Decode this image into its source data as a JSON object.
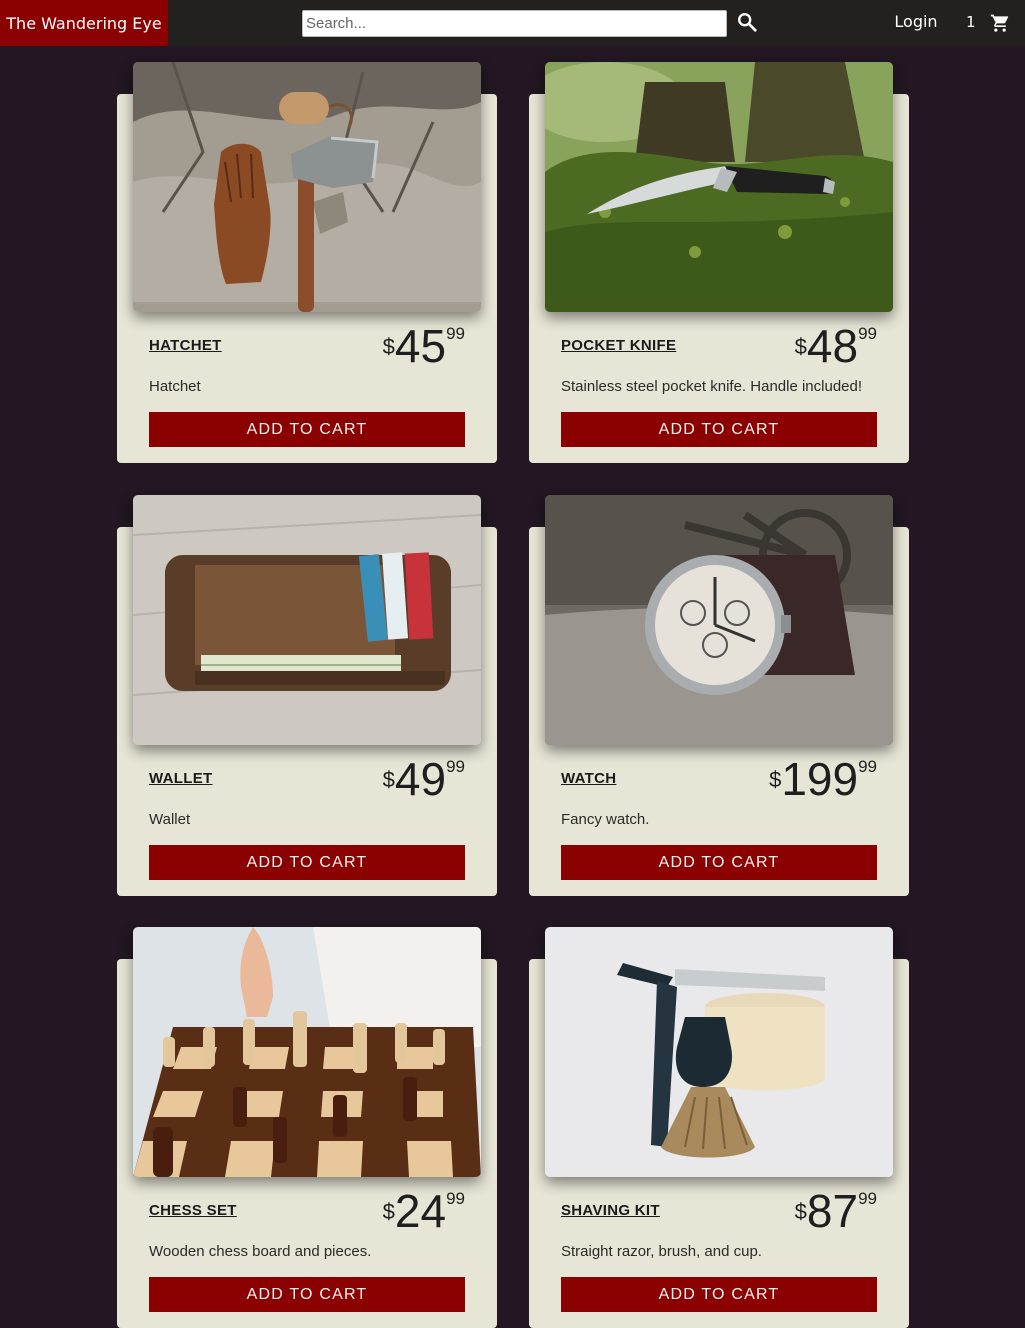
{
  "header": {
    "brand": "The Wandering Eye",
    "search_placeholder": "Search...",
    "search_icon": "search-icon",
    "login_label": "Login",
    "cart_count": "1",
    "cart_icon": "cart-icon",
    "colors": {
      "bar": "#23211f",
      "brand": "#8b0000"
    }
  },
  "products": [
    {
      "name": "HATCHET",
      "currency": "$",
      "dollars": "45",
      "cents": "99",
      "description": "Hatchet",
      "button": "ADD TO CART",
      "image": "hatchet-photo"
    },
    {
      "name": "POCKET KNIFE",
      "currency": "$",
      "dollars": "48",
      "cents": "99",
      "description": "Stainless steel pocket knife. Handle included!",
      "button": "ADD TO CART",
      "image": "pocket-knife-photo"
    },
    {
      "name": "WALLET",
      "currency": "$",
      "dollars": "49",
      "cents": "99",
      "description": "Wallet",
      "button": "ADD TO CART",
      "image": "wallet-photo"
    },
    {
      "name": "WATCH",
      "currency": "$",
      "dollars": "199",
      "cents": "99",
      "description": "Fancy watch.",
      "button": "ADD TO CART",
      "image": "watch-photo"
    },
    {
      "name": "CHESS SET",
      "currency": "$",
      "dollars": "24",
      "cents": "99",
      "description": "Wooden chess board and pieces.",
      "button": "ADD TO CART",
      "image": "chess-set-photo"
    },
    {
      "name": "SHAVING KIT",
      "currency": "$",
      "dollars": "87",
      "cents": "99",
      "description": "Straight razor, brush, and cup.",
      "button": "ADD TO CART",
      "image": "shaving-kit-photo"
    }
  ],
  "colors": {
    "page_bg": "#221722",
    "card_bg": "#e7e6d6",
    "button_bg": "#8b0000"
  }
}
